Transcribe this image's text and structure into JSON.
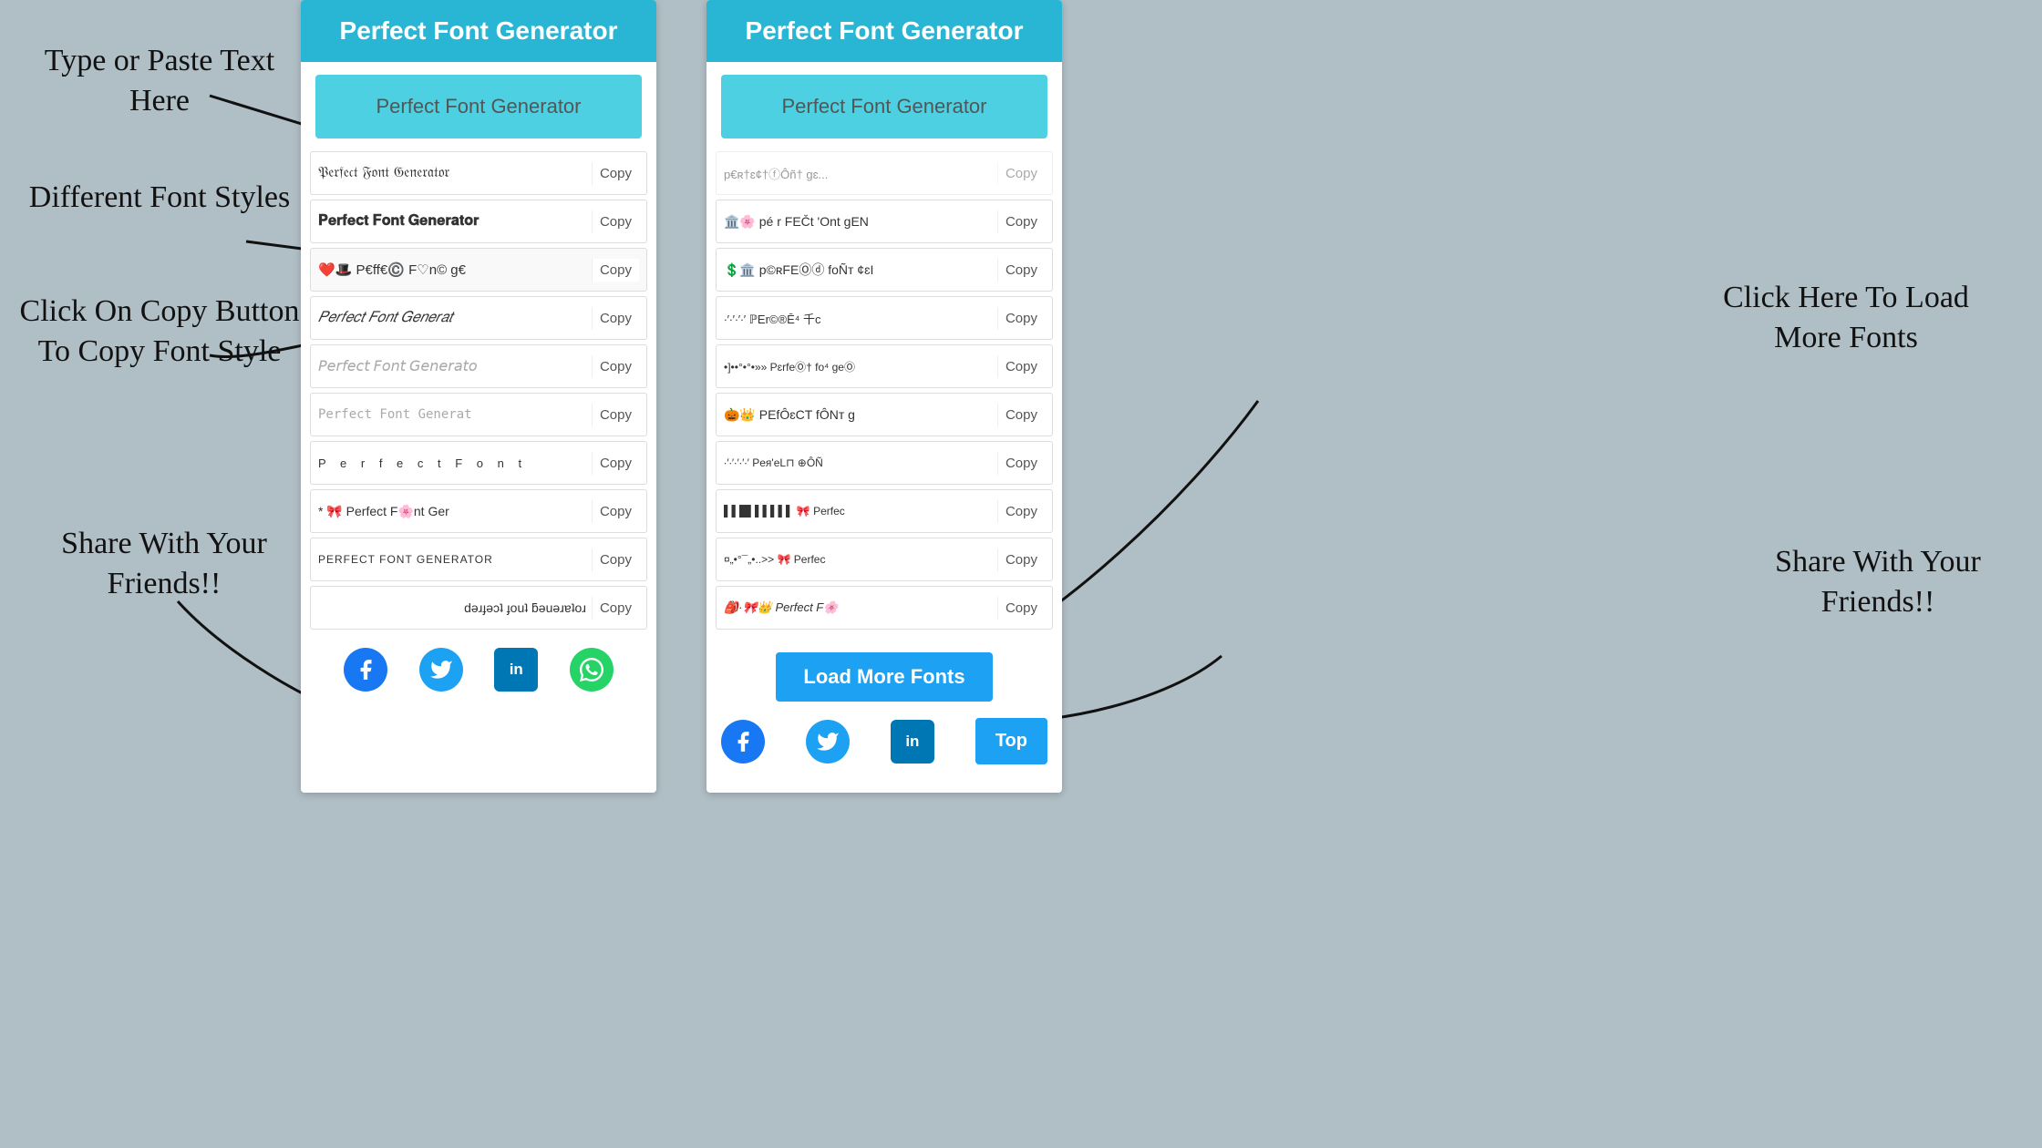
{
  "background_color": "#b0bec5",
  "annotations": {
    "type_paste": "Type or Paste Text\nHere",
    "different_fonts": "Different Font\nStyles",
    "click_copy": "Click On Copy\nButton To Copy\nFont Style",
    "share": "Share With\nYour\nFriends!!",
    "click_load": "Click Here To\nLoad More\nFonts",
    "share_right": "Share With\nYour\nFriends!!"
  },
  "left_panel": {
    "title": "Perfect Font Generator",
    "input_placeholder": "Perfect Font Generator",
    "font_rows": [
      {
        "text": "𝔓𝔢𝔯𝔣𝔢𝔠𝔱 𝔉𝔬𝔫𝔱 𝔊𝔢𝔫𝔢𝔯𝔞𝔱𝔬𝔯",
        "copy": "Copy",
        "style": "old-english"
      },
      {
        "text": "𝐏𝐞𝐫𝐟𝐞𝐜𝐭 𝐅𝐨𝐧𝐭 𝐆𝐞𝐧𝐞𝐫𝐚𝐭𝐨𝐫",
        "copy": "Copy",
        "style": "bold"
      },
      {
        "text": "❤️🎩 P€ff€©️ F♡n© g€",
        "copy": "Copy",
        "style": "emoji"
      },
      {
        "text": "𝑃𝑒𝑟𝑓𝑒𝑐𝑡 𝐹𝑜𝑛𝑡 𝐺𝑒𝑛𝑒𝑟𝑎𝑡",
        "copy": "Copy",
        "style": "italic"
      },
      {
        "text": "𝘗𝘦𝘳𝘧𝘦𝘤𝘵 𝘍𝘰𝘯𝘵 𝘎𝘦𝘯𝘦𝘳𝘢𝘵𝘰",
        "copy": "Copy",
        "style": "italic2"
      },
      {
        "text": "𝙿𝚎𝚛𝚏𝚎𝚌𝚝 𝙵𝚘𝚗𝚝 𝙶𝚎𝚗𝚎𝚛𝚊𝚝𝚘𝚛",
        "copy": "Copy",
        "style": "mono"
      },
      {
        "text": "P  e  r  f  e  c  t   F  o  n  t",
        "copy": "Copy",
        "style": "spaced"
      },
      {
        "text": "* 🎀 Perfect F🌸nt Ger",
        "copy": "Copy",
        "style": "emoji2"
      },
      {
        "text": "PERFECT FONT GENERATOR",
        "copy": "Copy",
        "style": "caps"
      },
      {
        "text": "ɹoʇɐɹǝuǝƃ ʇuoɟ ʇɔǝɟɹǝd",
        "copy": "Copy",
        "style": "reversed"
      }
    ],
    "social": {
      "facebook": "f",
      "twitter": "𝕥",
      "linkedin": "in",
      "whatsapp": "w"
    }
  },
  "right_panel": {
    "title": "Perfect Font Generator",
    "input_placeholder": "Perfect Font Generator",
    "font_rows": [
      {
        "text": "p€ʀ†ɛ¢†ⓕÔñ† gɛ",
        "copy": "Copy",
        "style": "partial",
        "partial": true
      },
      {
        "text": "pé r FEČt 'Ont gEN",
        "copy": "Copy",
        "style": "mixed"
      },
      {
        "text": "p©ʀFEⓄⓓ foÑт ¢ɛI",
        "copy": "Copy",
        "style": "mixed2"
      },
      {
        "text": "∙′∙′∙′∙′ ℙEr©®Ē⁴ 千c",
        "copy": "Copy",
        "style": "dots"
      },
      {
        "text": "•]••°•°•»» PɛrfeⓄ† fo⁴ geⓄ",
        "copy": "Copy",
        "style": "border"
      },
      {
        "text": "🎃👑 PEfÔɛCT fÔNт g",
        "copy": "Copy",
        "style": "emoji3"
      },
      {
        "text": "∙′∙′∙′∙′∙′ Pея'eL⊓ ⊕ÔÑ",
        "copy": "Copy",
        "style": "dots2"
      },
      {
        "text": "▌▌█▌▌▌▌▌▌ 🎀 Perfec",
        "copy": "Copy",
        "style": "barcode"
      },
      {
        "text": "¤„•°¯„•..>>  🎀 Perfec",
        "copy": "Copy",
        "style": "deco"
      },
      {
        "text": "🎒·🎀👑 Perfect F🌸",
        "copy": "Copy",
        "style": "emoji4"
      }
    ],
    "load_more": "Load More Fonts",
    "top_btn": "Top",
    "social": {
      "facebook": "f",
      "twitter": "𝕥",
      "linkedin": "in"
    }
  },
  "copy_label": "Copy",
  "colors": {
    "header": "#29b6d4",
    "input_bg": "#4dd0e1",
    "load_more_btn": "#1da1f2",
    "top_btn": "#29b6d4",
    "facebook": "#1877f2",
    "twitter": "#1da1f2",
    "linkedin": "#0077b5",
    "whatsapp": "#25d366"
  }
}
